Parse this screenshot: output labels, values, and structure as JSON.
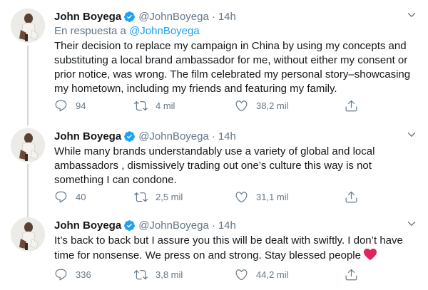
{
  "tweets": [
    {
      "name": "John Boyega",
      "handle": "@JohnBoyega",
      "dot": "·",
      "time": "14h",
      "reply_prefix": "En respuesta a",
      "reply_mention": "@JohnBoyega",
      "text": "Their decision to replace my campaign in China by using my concepts and substituting a local brand ambassador for me, without either my consent or prior notice, was wrong. The film celebrated my personal story–showcasing my hometown, including my friends and featuring my family.",
      "replies": "94",
      "retweets": "4 mil",
      "likes": "38,2 mil"
    },
    {
      "name": "John Boyega",
      "handle": "@JohnBoyega",
      "dot": "·",
      "time": "14h",
      "text": "While many brands understandably use a variety of global and local ambassadors , dismissively trading out one’s culture this way is not something I can condone.",
      "replies": "40",
      "retweets": "2,5 mil",
      "likes": "31,1 mil"
    },
    {
      "name": "John Boyega",
      "handle": "@JohnBoyega",
      "dot": "·",
      "time": "14h",
      "text": "It’s back to back but I assure you this will be dealt with swiftly. I don’t have time for nonsense. We press on and strong. Stay blessed people",
      "replies": "336",
      "retweets": "3,8 mil",
      "likes": "44,2 mil"
    }
  ],
  "colors": {
    "accent": "#1da1f2",
    "muted": "#657786",
    "text": "#14171a",
    "heart": "#e0245e",
    "thread_line": "#cfd9de"
  },
  "icons": [
    "avatar",
    "verified-badge-icon",
    "chevron-down-icon",
    "reply-icon",
    "retweet-icon",
    "like-icon",
    "share-icon",
    "red-heart-emoji"
  ]
}
